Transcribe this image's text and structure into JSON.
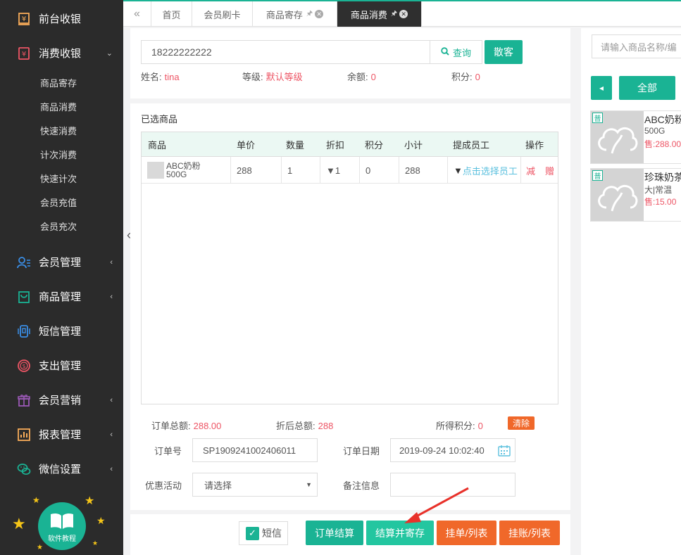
{
  "sidebar": {
    "items": [
      {
        "label": "前台收银",
        "icon": "cash-register-icon"
      },
      {
        "label": "消费收银",
        "icon": "yuan-card-icon"
      },
      {
        "label": "会员管理",
        "icon": "members-icon"
      },
      {
        "label": "商品管理",
        "icon": "shopping-bag-icon"
      },
      {
        "label": "短信管理",
        "icon": "phone-icon"
      },
      {
        "label": "支出管理",
        "icon": "coin-icon"
      },
      {
        "label": "会员营销",
        "icon": "gift-icon"
      },
      {
        "label": "报表管理",
        "icon": "report-icon"
      },
      {
        "label": "微信设置",
        "icon": "wechat-icon"
      }
    ],
    "sub_items": [
      "商品寄存",
      "商品消费",
      "快速消费",
      "计次消费",
      "快速计次",
      "会员充值",
      "会员充次"
    ],
    "tutorial_label": "软件教程"
  },
  "tabs": [
    {
      "label": "首页"
    },
    {
      "label": "会员刷卡"
    },
    {
      "label": "商品寄存"
    },
    {
      "label": "商品消费"
    }
  ],
  "member": {
    "search_value": "18222222222",
    "query_label": "查询",
    "guest_label": "散客",
    "name_label": "姓名:",
    "name_value": "tina",
    "level_label": "等级:",
    "level_value": "默认等级",
    "balance_label": "余额:",
    "balance_value": "0",
    "points_label": "积分:",
    "points_value": "0"
  },
  "selected": {
    "title": "已选商品",
    "columns": [
      "商品",
      "单价",
      "数量",
      "折扣",
      "积分",
      "小计",
      "提成员工",
      "操作"
    ],
    "rows": [
      {
        "name_line1": "ABC奶粉",
        "name_line2": "500G",
        "price": "288",
        "qty": "1",
        "discount": "▼1",
        "points": "0",
        "subtotal": "288",
        "staff": "点击选择员工",
        "reduce": "减",
        "gift": "赠"
      }
    ]
  },
  "summary": {
    "order_total_label": "订单总额:",
    "order_total_value": "288.00",
    "discount_total_label": "折后总额:",
    "discount_total_value": "288",
    "earned_points_label": "所得积分:",
    "earned_points_value": "0",
    "clear_label": "清除"
  },
  "form": {
    "order_no_label": "订单号",
    "order_no_value": "SP1909241002406011",
    "order_date_label": "订单日期",
    "order_date_value": "2019-09-24 10:02:40",
    "promo_label": "优惠活动",
    "promo_value": "请选择",
    "remark_label": "备注信息",
    "remark_value": ""
  },
  "actions": {
    "sms_label": "短信",
    "settle": "订单结算",
    "settle_store": "结算并寄存",
    "hold_list": "挂单/列表",
    "credit_list": "挂账/列表"
  },
  "right": {
    "search_placeholder": "请输入商品名称/编",
    "all_label": "全部",
    "products": [
      {
        "badge": "普",
        "name": "ABC奶粉",
        "spec": "500G",
        "price": "售:288.00"
      },
      {
        "badge": "普",
        "name": "珍珠奶茶",
        "spec": "大|常温",
        "price": "售:15.00"
      }
    ]
  },
  "colors": {
    "accent": "#1ab394",
    "sidebar_bg": "#2b2b2b",
    "orange": "#f0682a",
    "red_text": "#ed5565"
  }
}
